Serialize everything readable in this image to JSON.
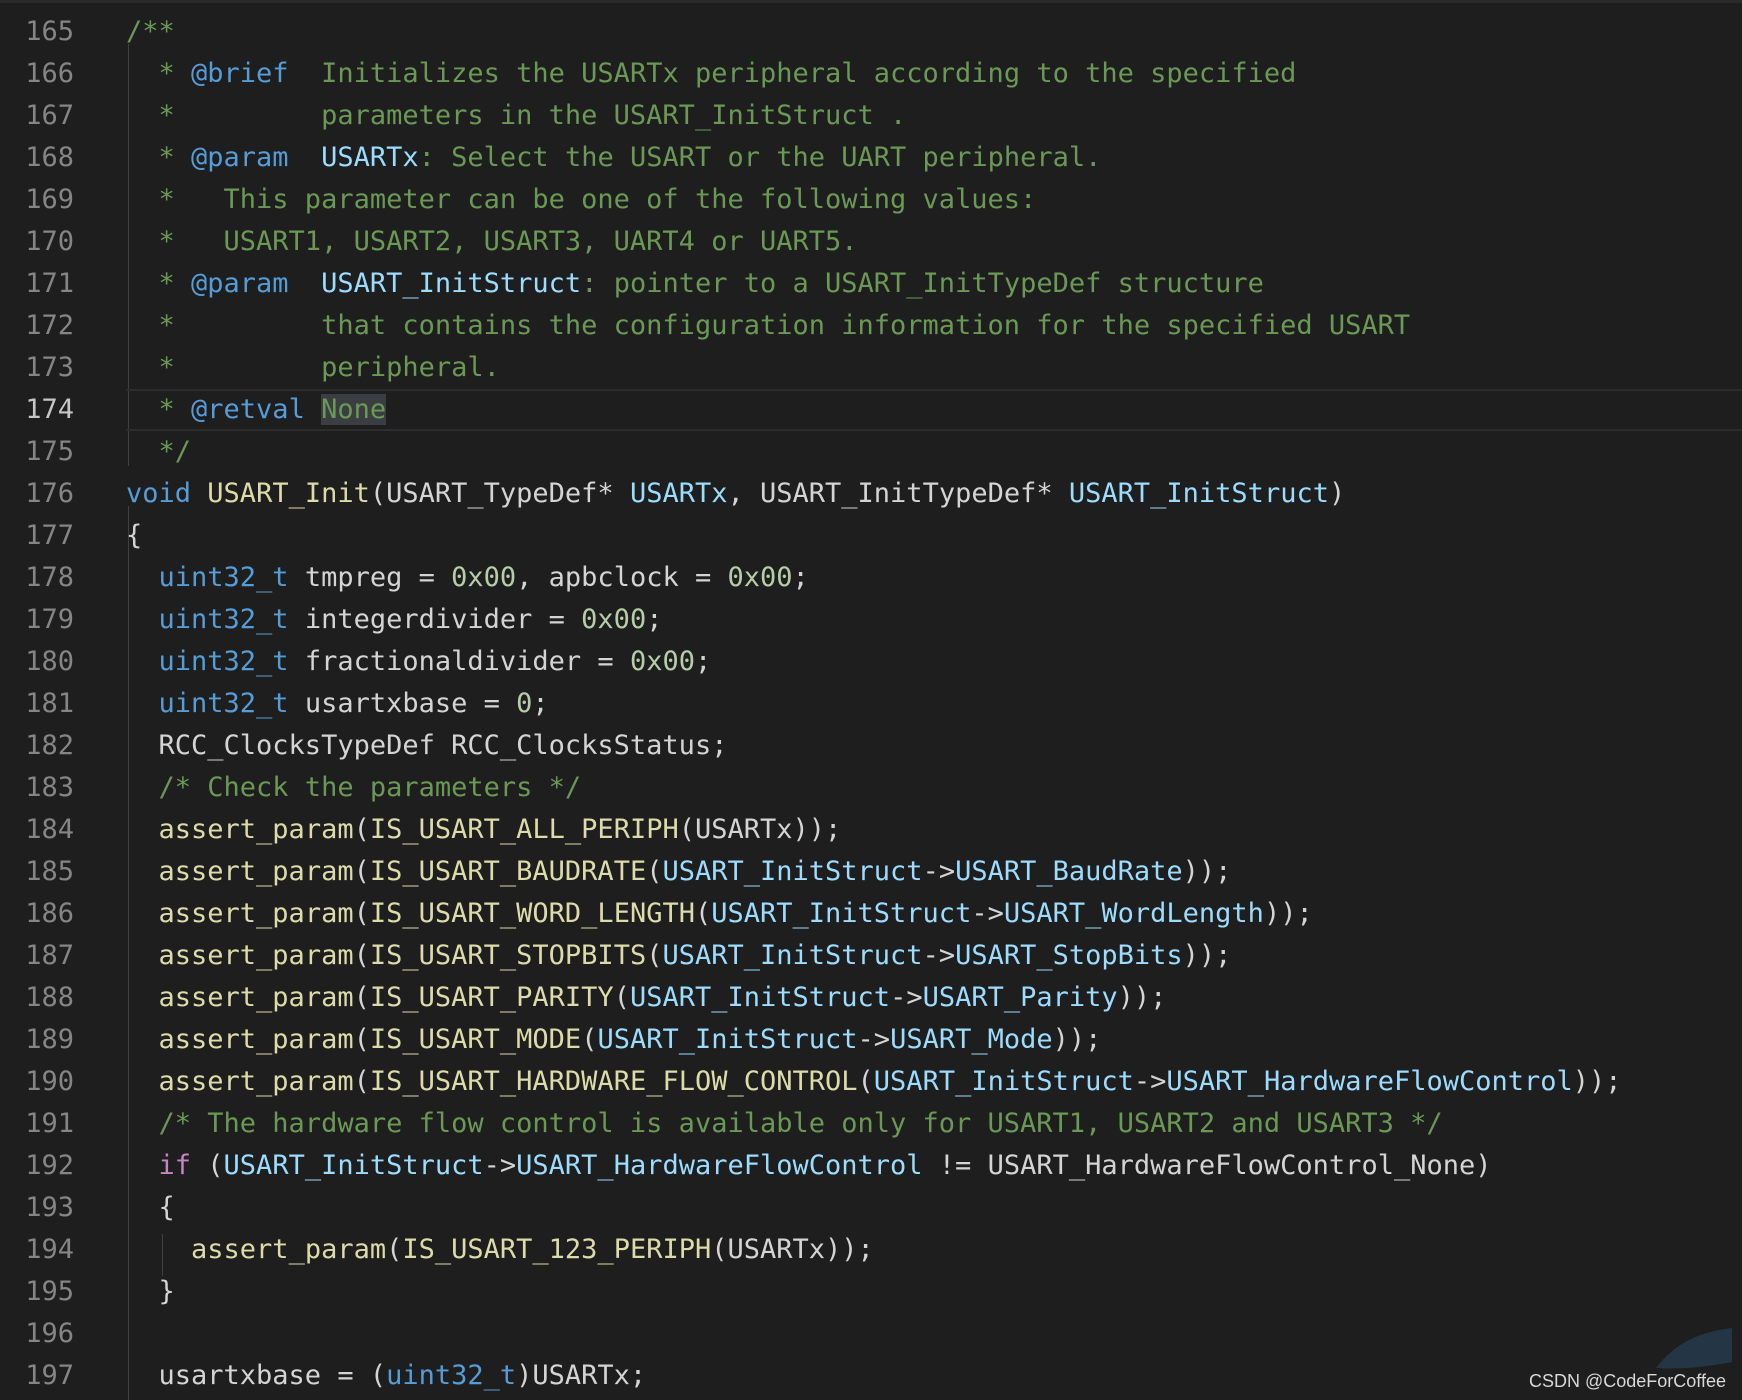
{
  "editor": {
    "active_line": "174",
    "lines": [
      {
        "n": "165",
        "c": "/**"
      },
      {
        "n": "166",
        "c": "  * @brief  Initializes the USARTx peripheral according to the specified"
      },
      {
        "n": "167",
        "c": "  *         parameters in the USART_InitStruct ."
      },
      {
        "n": "168",
        "c": "  * @param  USARTx: Select the USART or the UART peripheral."
      },
      {
        "n": "169",
        "c": "  *   This parameter can be one of the following values:"
      },
      {
        "n": "170",
        "c": "  *   USART1, USART2, USART3, UART4 or UART5."
      },
      {
        "n": "171",
        "c": "  * @param  USART_InitStruct: pointer to a USART_InitTypeDef structure"
      },
      {
        "n": "172",
        "c": "  *         that contains the configuration information for the specified USART"
      },
      {
        "n": "173",
        "c": "  *         peripheral."
      },
      {
        "n": "174",
        "c": "  * @retval None"
      },
      {
        "n": "175",
        "c": "  */"
      },
      {
        "n": "176",
        "c": "void USART_Init(USART_TypeDef* USARTx, USART_InitTypeDef* USART_InitStruct)"
      },
      {
        "n": "177",
        "c": "{"
      },
      {
        "n": "178",
        "c": "  uint32_t tmpreg = 0x00, apbclock = 0x00;"
      },
      {
        "n": "179",
        "c": "  uint32_t integerdivider = 0x00;"
      },
      {
        "n": "180",
        "c": "  uint32_t fractionaldivider = 0x00;"
      },
      {
        "n": "181",
        "c": "  uint32_t usartxbase = 0;"
      },
      {
        "n": "182",
        "c": "  RCC_ClocksTypeDef RCC_ClocksStatus;"
      },
      {
        "n": "183",
        "c": "  /* Check the parameters */"
      },
      {
        "n": "184",
        "c": "  assert_param(IS_USART_ALL_PERIPH(USARTx));"
      },
      {
        "n": "185",
        "c": "  assert_param(IS_USART_BAUDRATE(USART_InitStruct->USART_BaudRate));"
      },
      {
        "n": "186",
        "c": "  assert_param(IS_USART_WORD_LENGTH(USART_InitStruct->USART_WordLength));"
      },
      {
        "n": "187",
        "c": "  assert_param(IS_USART_STOPBITS(USART_InitStruct->USART_StopBits));"
      },
      {
        "n": "188",
        "c": "  assert_param(IS_USART_PARITY(USART_InitStruct->USART_Parity));"
      },
      {
        "n": "189",
        "c": "  assert_param(IS_USART_MODE(USART_InitStruct->USART_Mode));"
      },
      {
        "n": "190",
        "c": "  assert_param(IS_USART_HARDWARE_FLOW_CONTROL(USART_InitStruct->USART_HardwareFlowControl));"
      },
      {
        "n": "191",
        "c": "  /* The hardware flow control is available only for USART1, USART2 and USART3 */"
      },
      {
        "n": "192",
        "c": "  if (USART_InitStruct->USART_HardwareFlowControl != USART_HardwareFlowControl_None)"
      },
      {
        "n": "193",
        "c": "  {"
      },
      {
        "n": "194",
        "c": "    assert_param(IS_USART_123_PERIPH(USARTx));"
      },
      {
        "n": "195",
        "c": "  }"
      },
      {
        "n": "196",
        "c": ""
      },
      {
        "n": "197",
        "c": "  usartxbase = (uint32_t)USARTx;"
      }
    ]
  },
  "theme": {
    "background": "#1e1e1e",
    "comment": "#6a9955",
    "keyword": "#569cd6",
    "control": "#c586c0",
    "function": "#dcdcaa",
    "parameter": "#9cdcfe",
    "number": "#b5cea8",
    "text": "#d4d4d4"
  },
  "watermark": {
    "text": "CSDN @CodeForCoffee"
  }
}
